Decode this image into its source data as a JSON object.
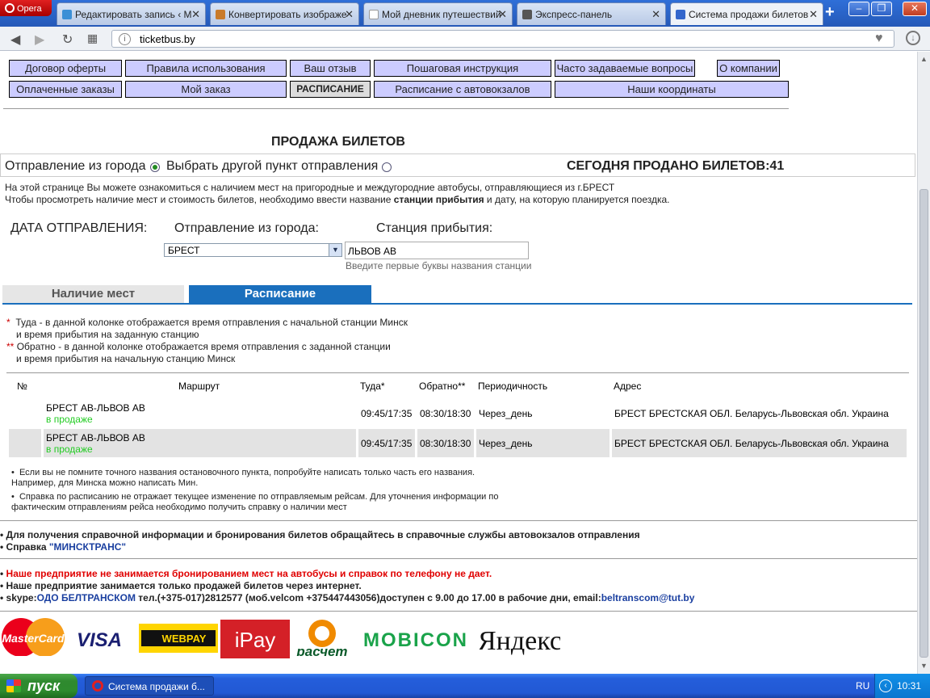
{
  "browser": {
    "app_name": "Opera",
    "tabs": [
      {
        "label": "Редактировать запись ‹ М",
        "color": "#3b8fd6"
      },
      {
        "label": "Конвертировать изображе",
        "color": "#c97b2a"
      },
      {
        "label": "Мой дневник путешествий",
        "color": "#999999"
      },
      {
        "label": "Экспресс-панель",
        "color": "#555555"
      },
      {
        "label": "Система продажи билетов",
        "color": "#3366cc"
      }
    ],
    "new_tab": "+",
    "url": "ticketbus.by"
  },
  "menu": {
    "row1": [
      "Договор оферты",
      "Правила использования",
      "Ваш отзыв",
      "Пошаговая инструкция",
      "Часто задаваемые вопросы",
      "О компании"
    ],
    "row2": [
      "Оплаченные заказы",
      "Мой заказ",
      "РАСПИСАНИЕ",
      "Расписание с автовокзалов",
      "Наши координаты"
    ]
  },
  "page": {
    "title": "ПРОДАЖА БИЛЕТОВ",
    "dep_from_city": "Отправление из города",
    "choose_other": "Выбрать другой пункт отправления",
    "sold_today": "СЕГОДНЯ ПРОДАНО БИЛЕТОВ:41",
    "info1": "На этой странице Вы можете ознакомиться с наличием мест на пригородные и междугородние автобусы, отправляющиеся из г.БРЕСТ",
    "info2_a": "Чтобы просмотреть наличие мест и стоимость билетов, необходимо ввести название ",
    "info2_b": "станции прибытия",
    "info2_c": " и дату, на которую планируется поездка."
  },
  "form": {
    "date_label": "ДАТА ОТПРАВЛЕНИЯ:",
    "from_label": "Отправление из города:",
    "to_label": "Станция прибытия:",
    "from_value": "БРЕСТ",
    "to_value": "ЛЬВОВ АВ",
    "hint": "Введите первые буквы названия станции"
  },
  "view_tabs": {
    "availability": "Наличие мест",
    "schedule": "Расписание"
  },
  "notes": {
    "n1_star": "*",
    "n1a": "Туда - в данной колонке отображается время отправления с начальной станции Минск",
    "n1b": "и время прибытия на заданную станцию",
    "n2_star": "**",
    "n2a": "Обратно - в данной колонке отображается время отправления с заданной станции",
    "n2b": "и время прибытия на начальную станцию Минск"
  },
  "table": {
    "headers": {
      "num": "№",
      "route": "Маршрут",
      "there": "Туда*",
      "back": "Обратно**",
      "period": "Периодичность",
      "address": "Адрес"
    },
    "rows": [
      {
        "route": "БРЕСТ АВ-ЛЬВОВ АВ",
        "status": "в продаже",
        "there": "09:45/17:35",
        "back": "08:30/18:30",
        "period": "Через_день",
        "address": "БРЕСТ БРЕСТСКАЯ ОБЛ. Беларусь-Львовская обл. Украина"
      },
      {
        "route": "БРЕСТ АВ-ЛЬВОВ АВ",
        "status": "в продаже",
        "there": "09:45/17:35",
        "back": "08:30/18:30",
        "period": "Через_день",
        "address": "БРЕСТ БРЕСТСКАЯ ОБЛ. Беларусь-Львовская обл. Украина"
      }
    ]
  },
  "tips": {
    "t1a": "Если вы не помните точного названия остановочного пункта, попробуйте написать только часть его названия.",
    "t1b": "Например, для Минска можно написать Мин.",
    "t2a": "Справка по расписанию не отражает текущее изменение по отправляемым рейсам. Для уточнения информации по",
    "t2b": "фактическим отправлениям рейса необходимо получить справку о наличии мест"
  },
  "footer": {
    "f1": "Для получения справочной информации и бронирования билетов обращайтесь в справочные службы автовокзалов отправления",
    "f2a": "Справка ",
    "f2b": "\"МИНСКТРАНС\"",
    "f3": "Наше предприятие не занимается бронированием мест на автобусы и справок по телефону не дает.",
    "f4": "Наше предприятие занимается только продажей билетов через интернет.",
    "f5a": "skype:",
    "f5b": "ОДО БЕЛТРАНСКОМ",
    "f5c": " тел.(+375-017)2812577 (моб.velcom +375447443056)доступен с 9.00 до 17.00 в рабочие дни, email:",
    "f5d": "beltranscom@tut.by"
  },
  "logos": [
    "MasterCard",
    "VISA",
    "WEBPAY",
    "iPay",
    "расчет",
    "MOBICON",
    "Яндекс"
  ],
  "taskbar": {
    "start": "пуск",
    "task": "Система продажи б...",
    "lang": "RU",
    "time": "10:31"
  }
}
